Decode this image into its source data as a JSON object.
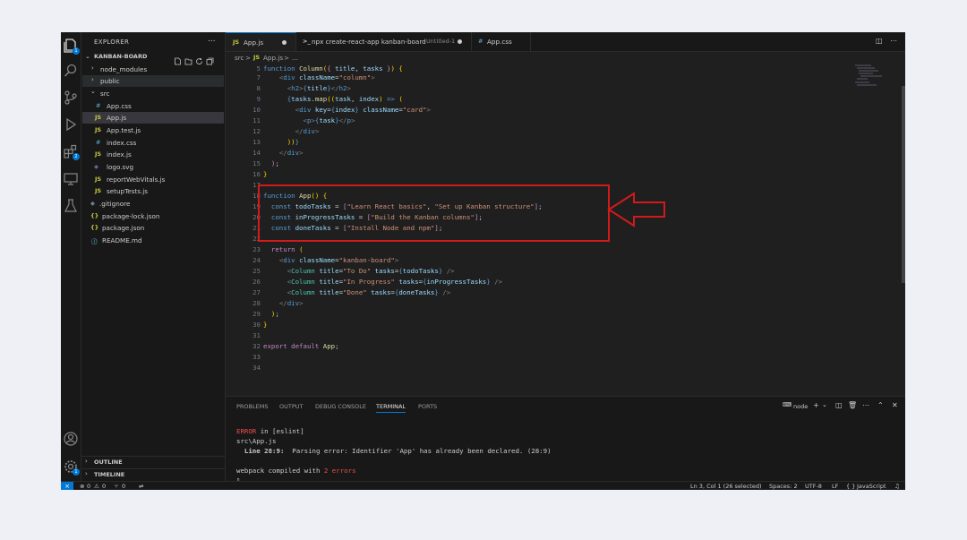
{
  "sidebar": {
    "title": "EXPLORER",
    "more": "...",
    "folder": "KANBAN-BOARD",
    "items": [
      {
        "label": "node_modules",
        "type": "folder"
      },
      {
        "label": "public",
        "type": "folder"
      },
      {
        "label": "src",
        "type": "folder"
      },
      {
        "label": "App.css",
        "icon": "#"
      },
      {
        "label": "App.js",
        "icon": "JS"
      },
      {
        "label": "App.test.js",
        "icon": "JS"
      },
      {
        "label": "index.css",
        "icon": "#"
      },
      {
        "label": "index.js",
        "icon": "JS"
      },
      {
        "label": "logo.svg",
        "icon": "svg"
      },
      {
        "label": "reportWebVitals.js",
        "icon": "JS"
      },
      {
        "label": "setupTests.js",
        "icon": "JS"
      },
      {
        "label": ".gitignore",
        "icon": "git"
      },
      {
        "label": "package-lock.json",
        "icon": "{}"
      },
      {
        "label": "package.json",
        "icon": "{}"
      },
      {
        "label": "README.md",
        "icon": "i"
      }
    ],
    "active_item": "App.js",
    "outline": "OUTLINE",
    "timeline": "TIMELINE"
  },
  "tabs": [
    {
      "icon": "JS",
      "label": "App.js",
      "modified": true,
      "active": true
    },
    {
      "icon": ">_",
      "label": "npx create-react-app kanban-board",
      "sub": "Untitled-1",
      "modified": true
    },
    {
      "icon": "#",
      "label": "App.css"
    }
  ],
  "breadcrumb": {
    "folder": "src",
    "sep": ">",
    "file_icon": "JS",
    "file": "App.js",
    "tail": "..."
  },
  "editor": {
    "lines": [
      {
        "num": "5",
        "code": "function Column({ title, tasks }) {"
      },
      {
        "num": "7",
        "code": "    <div className=\"column\">"
      },
      {
        "num": "8",
        "code": "      <h2>{title}</h2>"
      },
      {
        "num": "9",
        "code": "      {tasks.map((task, index) => ("
      },
      {
        "num": "10",
        "code": "        <div key={index} className=\"card\">"
      },
      {
        "num": "11",
        "code": "          <p>{task}</p>"
      },
      {
        "num": "12",
        "code": "        </div>"
      },
      {
        "num": "13",
        "code": "      ))}"
      },
      {
        "num": "14",
        "code": "    </div>"
      },
      {
        "num": "15",
        "code": "  );"
      },
      {
        "num": "16",
        "code": "}"
      },
      {
        "num": "17",
        "code": ""
      },
      {
        "num": "18",
        "code": "function App() {"
      },
      {
        "num": "19",
        "code": "  const todoTasks = [\"Learn React basics\", \"Set up Kanban structure\"];"
      },
      {
        "num": "20",
        "code": "  const inProgressTasks = [\"Build the Kanban columns\"];"
      },
      {
        "num": "21",
        "code": "  const doneTasks = [\"Install Node and npm\"];"
      },
      {
        "num": "22",
        "code": ""
      },
      {
        "num": "23",
        "code": "  return ("
      },
      {
        "num": "24",
        "code": "    <div className=\"kanban-board\">"
      },
      {
        "num": "25",
        "code": "      <Column title=\"To Do\" tasks={todoTasks} />"
      },
      {
        "num": "26",
        "code": "      <Column title=\"In Progress\" tasks={inProgressTasks} />"
      },
      {
        "num": "27",
        "code": "      <Column title=\"Done\" tasks={doneTasks} />"
      },
      {
        "num": "28",
        "code": "    </div>"
      },
      {
        "num": "29",
        "code": "  );"
      },
      {
        "num": "30",
        "code": "}"
      },
      {
        "num": "31",
        "code": ""
      },
      {
        "num": "32",
        "code": "export default App;"
      },
      {
        "num": "33",
        "code": ""
      },
      {
        "num": "34",
        "code": ""
      }
    ]
  },
  "panel": {
    "tabs": [
      "PROBLEMS",
      "OUTPUT",
      "DEBUG CONSOLE",
      "TERMINAL",
      "PORTS"
    ],
    "active_tab": "TERMINAL",
    "shell": "node",
    "terminal": {
      "error_word": "ERROR",
      "error_rest": " in [eslint]",
      "file": "src\\App.js",
      "detail_loc": "Line 28:9:",
      "detail_msg": "  Parsing error: Identifier 'App' has already been declared. (28:9)",
      "compiled": "webpack compiled with ",
      "errors": "2 errors",
      "cursor": "▯"
    }
  },
  "statusbar": {
    "errors": "0",
    "warnings": "0",
    "ports": "0",
    "position": "Ln 3, Col 1 (26 selected)",
    "spaces": "Spaces: 2",
    "encoding": "UTF-8",
    "eol": "LF",
    "language": "JavaScript",
    "language_icon": "{ }"
  },
  "colors": {
    "accent": "#0078d4",
    "highlight_box": "#d11a1a",
    "error": "#f14c4c"
  }
}
